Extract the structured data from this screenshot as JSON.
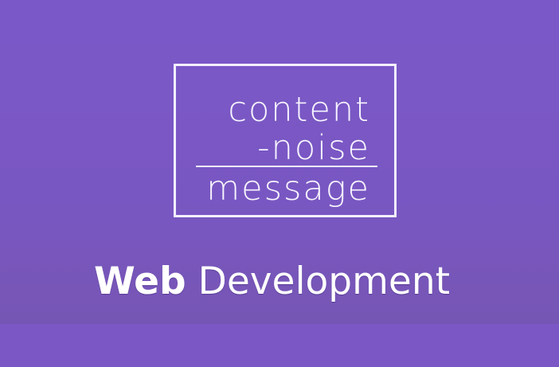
{
  "logo": {
    "line1": "content",
    "line2": "-noise",
    "line3": "message"
  },
  "title": {
    "strong": "Web",
    "light": "Development"
  },
  "colors": {
    "background": "#7b57c6",
    "foreground": "#ffffff"
  }
}
